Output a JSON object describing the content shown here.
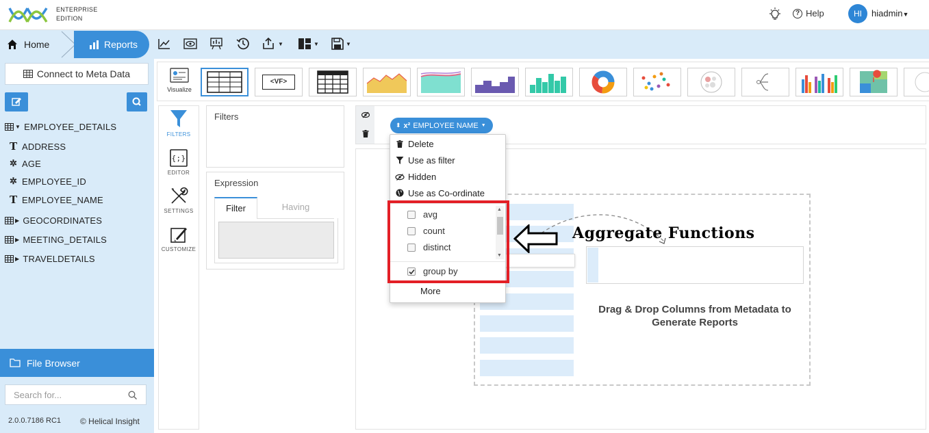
{
  "header": {
    "edition_line1": "ENTERPRISE",
    "edition_line2": "EDITION",
    "help_label": "Help",
    "avatar_initials": "HI",
    "username": "hiadmin"
  },
  "nav": {
    "home_label": "Home",
    "reports_label": "Reports"
  },
  "sidebar": {
    "connect_label": "Connect to Meta Data",
    "tree": [
      {
        "label": "EMPLOYEE_DETAILS"
      },
      {
        "label": "ADDRESS"
      },
      {
        "label": "AGE"
      },
      {
        "label": "EMPLOYEE_ID"
      },
      {
        "label": "EMPLOYEE_NAME"
      },
      {
        "label": "GEOCORDINATES"
      },
      {
        "label": "MEETING_DETAILS"
      },
      {
        "label": "TRAVELDETAILS"
      }
    ],
    "file_browser_label": "File Browser",
    "search_placeholder": "Search for...",
    "version": "2.0.0.7186 RC1",
    "copyright": "© Helical Insight"
  },
  "viz": {
    "visualize_label": "Visualize",
    "vf_label": "<VF>"
  },
  "tools": {
    "filters": "FILTERS",
    "editor": "EDITOR",
    "settings": "SETTINGS",
    "customize": "CUSTOMIZE"
  },
  "panels": {
    "filters_title": "Filters",
    "expression_title": "Expression",
    "tab_filter": "Filter",
    "tab_having": "Having"
  },
  "column_chip": {
    "label": "EMPLOYEE NAME"
  },
  "menu": {
    "delete": "Delete",
    "use_as_filter": "Use as filter",
    "hidden": "Hidden",
    "use_as_coordinate": "Use as Co-ordinate",
    "aggregates": [
      {
        "label": "avg",
        "checked": false
      },
      {
        "label": "count",
        "checked": false
      },
      {
        "label": "distinct",
        "checked": false
      }
    ],
    "group_by": "group by",
    "more": "More"
  },
  "canvas": {
    "drag_text": "Drag & Drop Columns from Metadata to Generate Reports",
    "annotation": "Aggregate Functions"
  },
  "colors": {
    "accent": "#3a8fd9",
    "panel_bg": "#d9ebf9",
    "highlight": "#e31f26"
  }
}
